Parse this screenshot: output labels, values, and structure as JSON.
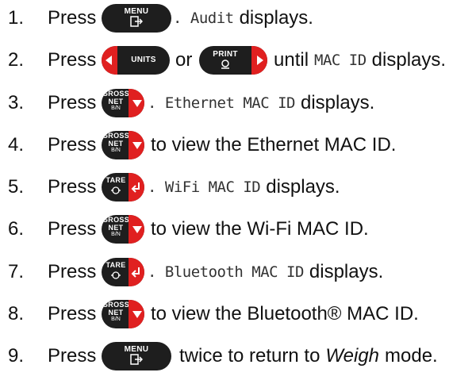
{
  "keys": {
    "menu": {
      "label": "MENU"
    },
    "units": {
      "label": "UNITS"
    },
    "print": {
      "label": "PRINT"
    },
    "gross": {
      "line1": "GROSS",
      "line2": "NET",
      "line3": "B/N"
    },
    "tare": {
      "label": "TARE"
    }
  },
  "press_label": "Press",
  "steps": [
    {
      "num": "1.",
      "mono": ". Audit",
      "text": "displays."
    },
    {
      "num": "2.",
      "or": "or",
      "until": "until",
      "mono": "MAC ID",
      "text": "displays."
    },
    {
      "num": "3.",
      "mono": ". Ethernet MAC ID",
      "text": "displays."
    },
    {
      "num": "4.",
      "text": "to view the Ethernet MAC ID."
    },
    {
      "num": "5.",
      "mono": ". WiFi MAC ID",
      "text": "displays."
    },
    {
      "num": "6.",
      "text": "to view the Wi-Fi MAC ID."
    },
    {
      "num": "7.",
      "mono": ". Bluetooth MAC ID",
      "text": "displays."
    },
    {
      "num": "8.",
      "text": "to view the Bluetooth® MAC ID."
    },
    {
      "num": "9.",
      "text_before": "twice to return to",
      "text_em": "Weigh",
      "text_after": "mode."
    }
  ]
}
